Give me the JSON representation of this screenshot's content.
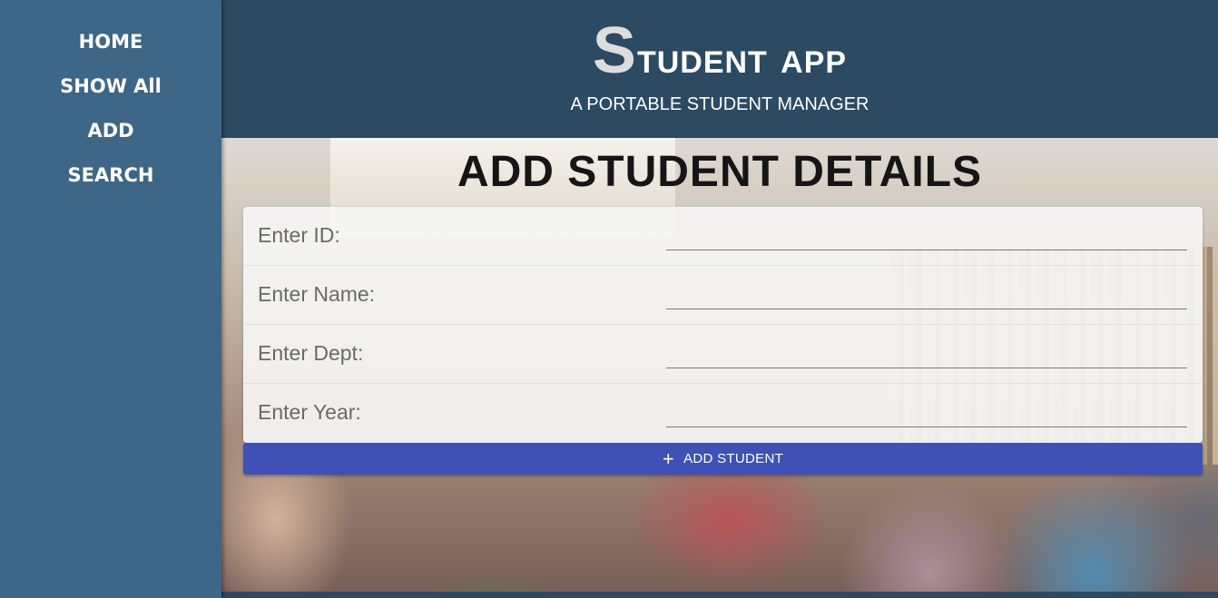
{
  "sidebar": {
    "items": [
      {
        "label": "HOME"
      },
      {
        "label": "SHOW All"
      },
      {
        "label": "ADD"
      },
      {
        "label": "SEARCH"
      }
    ]
  },
  "header": {
    "title_cap": "S",
    "title_rest": "tudent app",
    "subtitle": "A PORTABLE STUDENT MANAGER"
  },
  "form": {
    "title": "ADD STUDENT DETAILS",
    "fields": [
      {
        "label": "Enter ID:",
        "value": ""
      },
      {
        "label": "Enter Name:",
        "value": ""
      },
      {
        "label": "Enter Dept:",
        "value": ""
      },
      {
        "label": "Enter Year:",
        "value": ""
      }
    ],
    "submit_label": "ADD STUDENT",
    "submit_icon": "plus-icon"
  },
  "colors": {
    "sidebar_bg": "#3e6686",
    "header_bg": "#2c4a62",
    "button_bg": "#3f51b5"
  }
}
